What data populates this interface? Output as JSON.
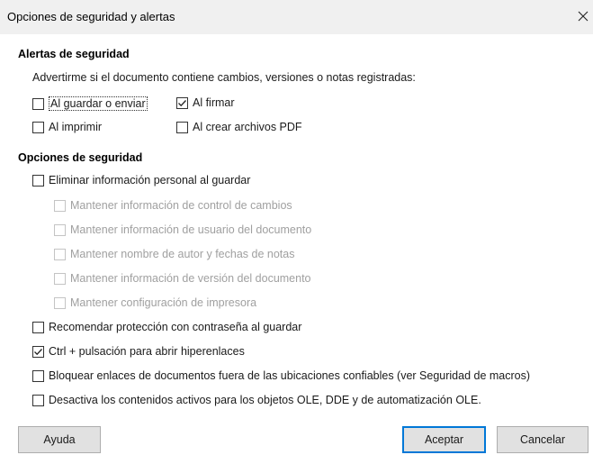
{
  "dialog": {
    "title": "Opciones de seguridad y alertas"
  },
  "alerts": {
    "heading": "Alertas de seguridad",
    "description": "Advertirme si el documento contiene cambios, versiones o notas registradas:",
    "options": [
      {
        "label": "Al guardar o enviar",
        "checked": false
      },
      {
        "label": "Al firmar",
        "checked": true
      },
      {
        "label": "Al imprimir",
        "checked": false
      },
      {
        "label": "Al crear archivos PDF",
        "checked": false
      }
    ]
  },
  "security": {
    "heading": "Opciones de seguridad",
    "remove_personal": {
      "label": "Eliminar información personal al guardar",
      "checked": false
    },
    "sub_options": [
      {
        "label": "Mantener información de control de cambios",
        "checked": false
      },
      {
        "label": "Mantener información de usuario del documento",
        "checked": false
      },
      {
        "label": "Mantener nombre de autor y fechas de notas",
        "checked": false
      },
      {
        "label": "Mantener información de versión del documento",
        "checked": false
      },
      {
        "label": "Mantener configuración de impresora",
        "checked": false
      }
    ],
    "options": [
      {
        "label": "Recomendar protección con contraseña al guardar",
        "checked": false
      },
      {
        "label": "Ctrl + pulsación para abrir hiperenlaces",
        "checked": true
      },
      {
        "label": "Bloquear enlaces de documentos fuera de las ubicaciones confiables (ver Seguridad de macros)",
        "checked": false
      },
      {
        "label": "Desactiva los contenidos activos para los objetos OLE, DDE y de automatización OLE.",
        "checked": false
      }
    ]
  },
  "buttons": {
    "help": "Ayuda",
    "ok": "Aceptar",
    "cancel": "Cancelar"
  },
  "colors": {
    "accent": "#0078d7",
    "disabled_text": "#a0a0a0"
  }
}
